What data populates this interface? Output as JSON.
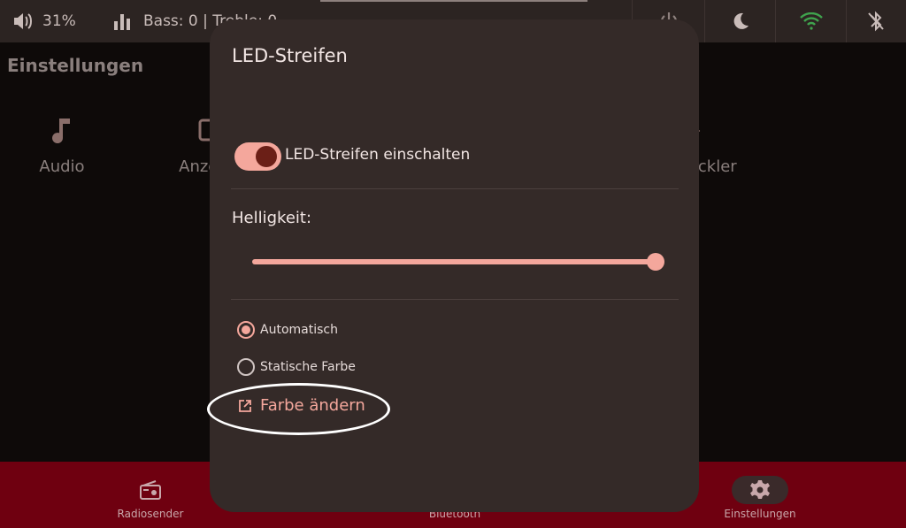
{
  "status_bar": {
    "volume_text": "31%",
    "equalizer_text": "Bass: 0  |  Treble: 0",
    "icons": [
      "volume-icon",
      "equalizer-icon",
      "power-icon",
      "night-mode-icon",
      "wifi-icon",
      "bluetooth-off-icon"
    ],
    "wifi_color": "#3fa34d"
  },
  "page": {
    "title": "Einstellungen",
    "tiles": [
      {
        "label": "Audio",
        "icon": "music-note-icon"
      },
      {
        "label": "Anzeige",
        "icon": "display-icon"
      },
      {
        "label": "Entwickler",
        "icon": "developer-icon"
      }
    ]
  },
  "bottom_nav": {
    "items": [
      {
        "label": "Radiosender",
        "icon": "radio-icon"
      },
      {
        "label": "Bluetooth",
        "icon": "bluetooth-icon"
      },
      {
        "label": "Einstellungen",
        "icon": "gear-icon",
        "selected": true
      }
    ],
    "background": "#6f0010"
  },
  "dialog": {
    "title": "LED-Streifen",
    "toggle_label": "LED-Streifen einschalten",
    "toggle_on": true,
    "brightness_label": "Helligkeit:",
    "brightness_value": 1.0,
    "mode_options": [
      {
        "label": "Automatisch",
        "selected": true
      },
      {
        "label": "Statische Farbe",
        "selected": false
      }
    ],
    "change_color_label": "Farbe ändern",
    "accent": "#f4a79c"
  }
}
